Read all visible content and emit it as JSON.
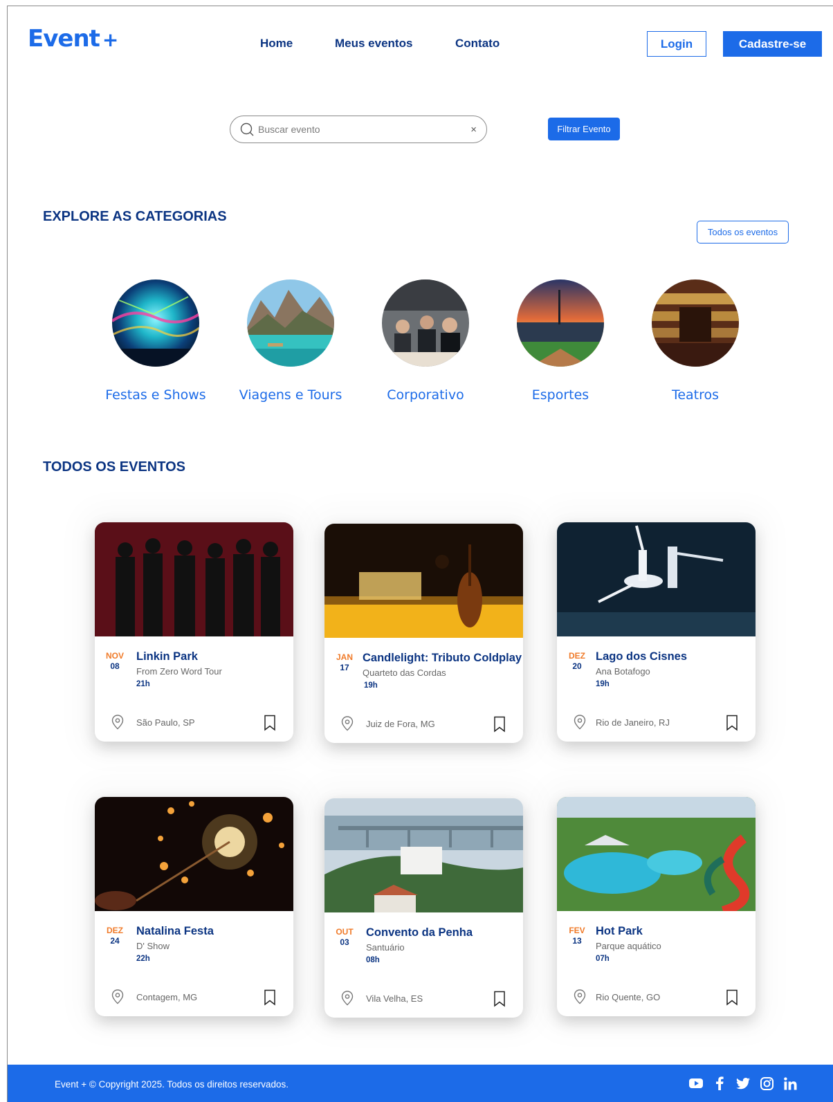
{
  "header": {
    "logo": "Event",
    "logo_plus": "+",
    "nav": [
      "Home",
      "Meus eventos",
      "Contato"
    ],
    "login": "Login",
    "signup": "Cadastre-se"
  },
  "search": {
    "placeholder": "Buscar evento",
    "clear": "×",
    "filter_button": "Filtrar Evento"
  },
  "categories": {
    "title": "EXPLORE AS CATEGORIAS",
    "all_button": "Todos os eventos",
    "items": [
      "Festas e Shows",
      "Viagens e Tours",
      "Corporativo",
      "Esportes",
      "Teatros"
    ]
  },
  "events": {
    "title": "TODOS OS EVENTOS",
    "items": [
      {
        "month": "NOV",
        "day": "08",
        "title": "Linkin Park",
        "subtitle": "From Zero Word Tour",
        "time": "21h",
        "location": "São Paulo, SP"
      },
      {
        "month": "JAN",
        "day": "17",
        "title": "Candlelight: Tributo Coldplay",
        "subtitle": "Quarteto das Cordas",
        "time": "19h",
        "location": "Juiz de Fora, MG"
      },
      {
        "month": "DEZ",
        "day": "20",
        "title": "Lago dos Cisnes",
        "subtitle": "Ana Botafogo",
        "time": "19h",
        "location": "Rio de Janeiro, RJ"
      },
      {
        "month": "DEZ",
        "day": "24",
        "title": "Natalina Festa",
        "subtitle": "D' Show",
        "time": "22h",
        "location": "Contagem, MG"
      },
      {
        "month": "OUT",
        "day": "03",
        "title": "Convento da Penha",
        "subtitle": "Santuário",
        "time": "08h",
        "location": "Vila Velha, ES"
      },
      {
        "month": "FEV",
        "day": "13",
        "title": "Hot Park",
        "subtitle": "Parque aquático",
        "time": "07h",
        "location": "Rio Quente, GO"
      }
    ]
  },
  "footer": {
    "copyright": "Event + © Copyright 2025. Todos os direitos reservados.",
    "social": [
      "youtube-icon",
      "facebook-icon",
      "twitter-icon",
      "instagram-icon",
      "linkedin-icon"
    ]
  },
  "colors": {
    "primary": "#1c6be8",
    "navy": "#0b3482",
    "month_orange": "#f07b2a"
  }
}
